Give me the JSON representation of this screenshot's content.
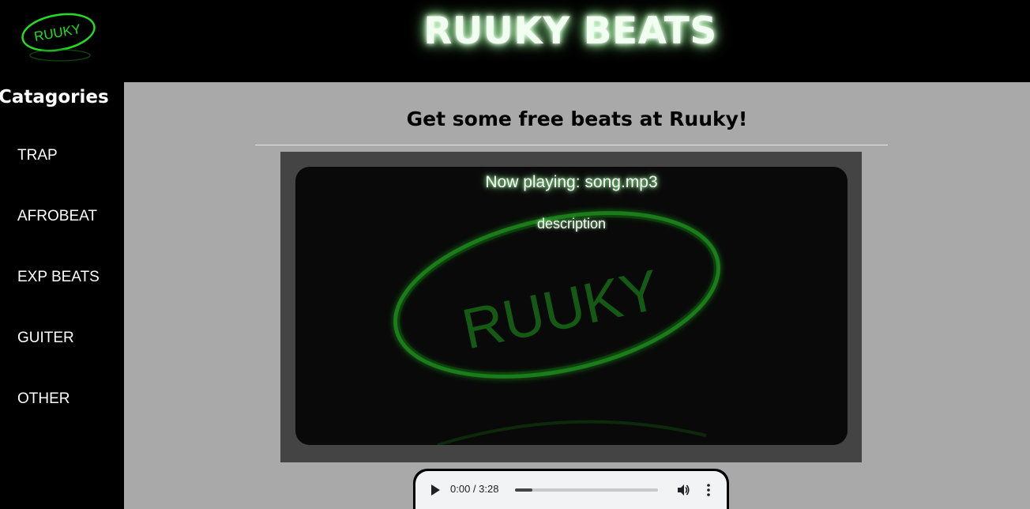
{
  "header": {
    "logo_text": "RUUKY",
    "title": "RUUKY BEATS"
  },
  "sidebar": {
    "heading": "Catagories",
    "items": [
      {
        "label": "TRAP"
      },
      {
        "label": "AFROBEAT"
      },
      {
        "label": "EXP BEATS"
      },
      {
        "label": "GUITER"
      },
      {
        "label": "OTHER"
      }
    ]
  },
  "main": {
    "heading": "Get some free beats at Ruuky!",
    "player": {
      "now_playing": "Now playing: song.mp3",
      "description": "description",
      "watermark_text": "RUUKY"
    },
    "audio": {
      "time": "0:00 / 3:28",
      "progress": 0.12,
      "icons": [
        "play-icon",
        "volume-icon",
        "more-vert-icon"
      ]
    }
  },
  "colors": {
    "accent_green": "#22cc22",
    "main_bg": "#a9a9a9",
    "frame_bg": "#444444",
    "card_bg": "#090909"
  }
}
